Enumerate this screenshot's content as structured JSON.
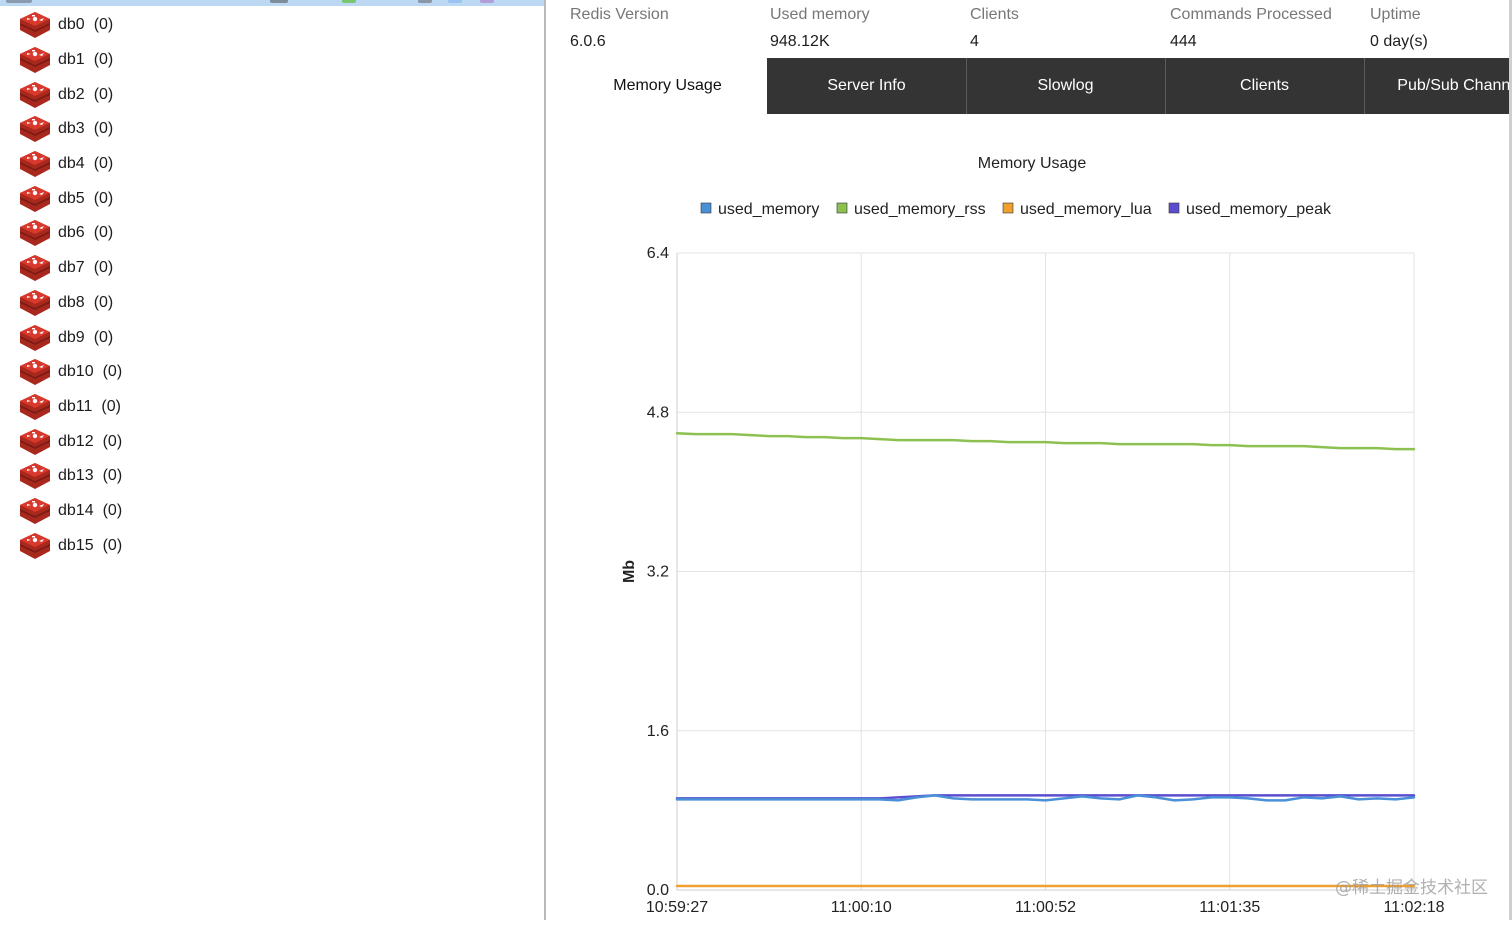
{
  "sidebar": {
    "databases": [
      {
        "name": "db0",
        "count": "(0)"
      },
      {
        "name": "db1",
        "count": "(0)"
      },
      {
        "name": "db2",
        "count": "(0)"
      },
      {
        "name": "db3",
        "count": "(0)"
      },
      {
        "name": "db4",
        "count": "(0)"
      },
      {
        "name": "db5",
        "count": "(0)"
      },
      {
        "name": "db6",
        "count": "(0)"
      },
      {
        "name": "db7",
        "count": "(0)"
      },
      {
        "name": "db8",
        "count": "(0)"
      },
      {
        "name": "db9",
        "count": "(0)"
      },
      {
        "name": "db10",
        "count": "(0)"
      },
      {
        "name": "db11",
        "count": "(0)"
      },
      {
        "name": "db12",
        "count": "(0)"
      },
      {
        "name": "db13",
        "count": "(0)"
      },
      {
        "name": "db14",
        "count": "(0)"
      },
      {
        "name": "db15",
        "count": "(0)"
      }
    ],
    "icon": "redis-database-icon"
  },
  "stats": [
    {
      "label": "Redis Version",
      "value": "6.0.6"
    },
    {
      "label": "Used memory",
      "value": "948.12K"
    },
    {
      "label": "Clients",
      "value": "4"
    },
    {
      "label": "Commands Processed",
      "value": "444"
    },
    {
      "label": "Uptime",
      "value": "0 day(s)"
    }
  ],
  "tabs": [
    {
      "label": "Memory Usage",
      "active": true
    },
    {
      "label": "Server Info",
      "active": false
    },
    {
      "label": "Slowlog",
      "active": false
    },
    {
      "label": "Clients",
      "active": false
    },
    {
      "label": "Pub/Sub Channels",
      "active": false
    }
  ],
  "chart_data": {
    "type": "line",
    "title": "Memory Usage",
    "ylabel": "Mb",
    "xlabel": "",
    "ylim": [
      0,
      6.4
    ],
    "y_ticks": [
      "0.0",
      "1.6",
      "3.2",
      "4.8",
      "6.4"
    ],
    "x_ticks": [
      "10:59:27",
      "11:00:10",
      "11:00:52",
      "11:01:35",
      "11:02:18"
    ],
    "grid": true,
    "legend_position": "top",
    "series": [
      {
        "name": "used_memory",
        "color": "#4a90d9",
        "values": [
          0.91,
          0.91,
          0.91,
          0.91,
          0.91,
          0.91,
          0.91,
          0.91,
          0.91,
          0.91,
          0.91,
          0.91,
          0.9,
          0.93,
          0.95,
          0.92,
          0.91,
          0.91,
          0.91,
          0.91,
          0.9,
          0.92,
          0.94,
          0.92,
          0.91,
          0.95,
          0.93,
          0.9,
          0.91,
          0.93,
          0.93,
          0.92,
          0.9,
          0.9,
          0.93,
          0.92,
          0.94,
          0.91,
          0.92,
          0.91,
          0.93
        ]
      },
      {
        "name": "used_memory_rss",
        "color": "#8cc152",
        "values": [
          4.59,
          4.58,
          4.58,
          4.58,
          4.57,
          4.56,
          4.56,
          4.55,
          4.55,
          4.54,
          4.54,
          4.53,
          4.52,
          4.52,
          4.52,
          4.52,
          4.51,
          4.51,
          4.5,
          4.5,
          4.5,
          4.49,
          4.49,
          4.49,
          4.48,
          4.48,
          4.48,
          4.48,
          4.48,
          4.47,
          4.47,
          4.46,
          4.46,
          4.46,
          4.46,
          4.45,
          4.44,
          4.44,
          4.44,
          4.43,
          4.43
        ]
      },
      {
        "name": "used_memory_lua",
        "color": "#f0a030",
        "values": [
          0.04,
          0.04,
          0.04,
          0.04,
          0.04,
          0.04,
          0.04,
          0.04,
          0.04,
          0.04,
          0.04,
          0.04,
          0.04,
          0.04,
          0.04,
          0.04,
          0.04,
          0.04,
          0.04,
          0.04,
          0.04,
          0.04,
          0.04,
          0.04,
          0.04,
          0.04,
          0.04,
          0.04,
          0.04,
          0.04,
          0.04,
          0.04,
          0.04,
          0.04,
          0.04,
          0.04,
          0.04,
          0.04,
          0.04,
          0.04,
          0.04
        ]
      },
      {
        "name": "used_memory_peak",
        "color": "#5b4fd0",
        "values": [
          0.92,
          0.92,
          0.92,
          0.92,
          0.92,
          0.92,
          0.92,
          0.92,
          0.92,
          0.92,
          0.92,
          0.92,
          0.93,
          0.94,
          0.95,
          0.95,
          0.95,
          0.95,
          0.95,
          0.95,
          0.95,
          0.95,
          0.95,
          0.95,
          0.95,
          0.95,
          0.95,
          0.95,
          0.95,
          0.95,
          0.95,
          0.95,
          0.95,
          0.95,
          0.95,
          0.95,
          0.95,
          0.95,
          0.95,
          0.95,
          0.95
        ]
      }
    ]
  },
  "watermark": "@稀土掘金技术社区"
}
